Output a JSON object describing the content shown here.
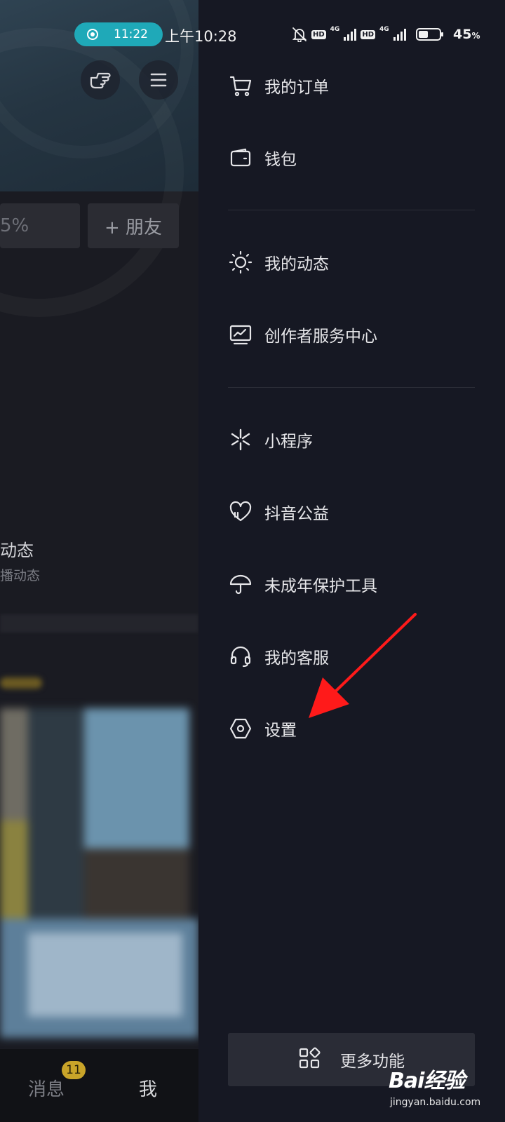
{
  "status_bar": {
    "recording_time": "11:22",
    "clock": "上午10:28",
    "network_1": "4G",
    "network_2": "4G",
    "hd_label": "HD",
    "battery_percent": "45",
    "battery_unit": "%",
    "battery_level": 0.45
  },
  "profile_background": {
    "follower_pct": "5%",
    "add_friend": "+ 朋友",
    "activity_title": "动态",
    "activity_subtitle": "播动态"
  },
  "bottom_nav": {
    "messages": "消息",
    "messages_badge": "11",
    "me": "我"
  },
  "drawer": {
    "items": [
      {
        "label": "我的订单",
        "icon": "cart-icon"
      },
      {
        "label": "钱包",
        "icon": "wallet-icon"
      },
      {
        "label": "我的动态",
        "icon": "sun-icon"
      },
      {
        "label": "创作者服务中心",
        "icon": "monitor-chart-icon"
      },
      {
        "label": "小程序",
        "icon": "spark-icon"
      },
      {
        "label": "抖音公益",
        "icon": "heart-icon"
      },
      {
        "label": "未成年保护工具",
        "icon": "umbrella-icon"
      },
      {
        "label": "我的客服",
        "icon": "headset-icon"
      },
      {
        "label": "设置",
        "icon": "hexagon-settings-icon"
      }
    ],
    "more_label": "更多功能",
    "annotation_color": "#ff1a1a"
  },
  "watermark": {
    "logo": "Bai经验",
    "url": "jingyan.baidu.com"
  }
}
